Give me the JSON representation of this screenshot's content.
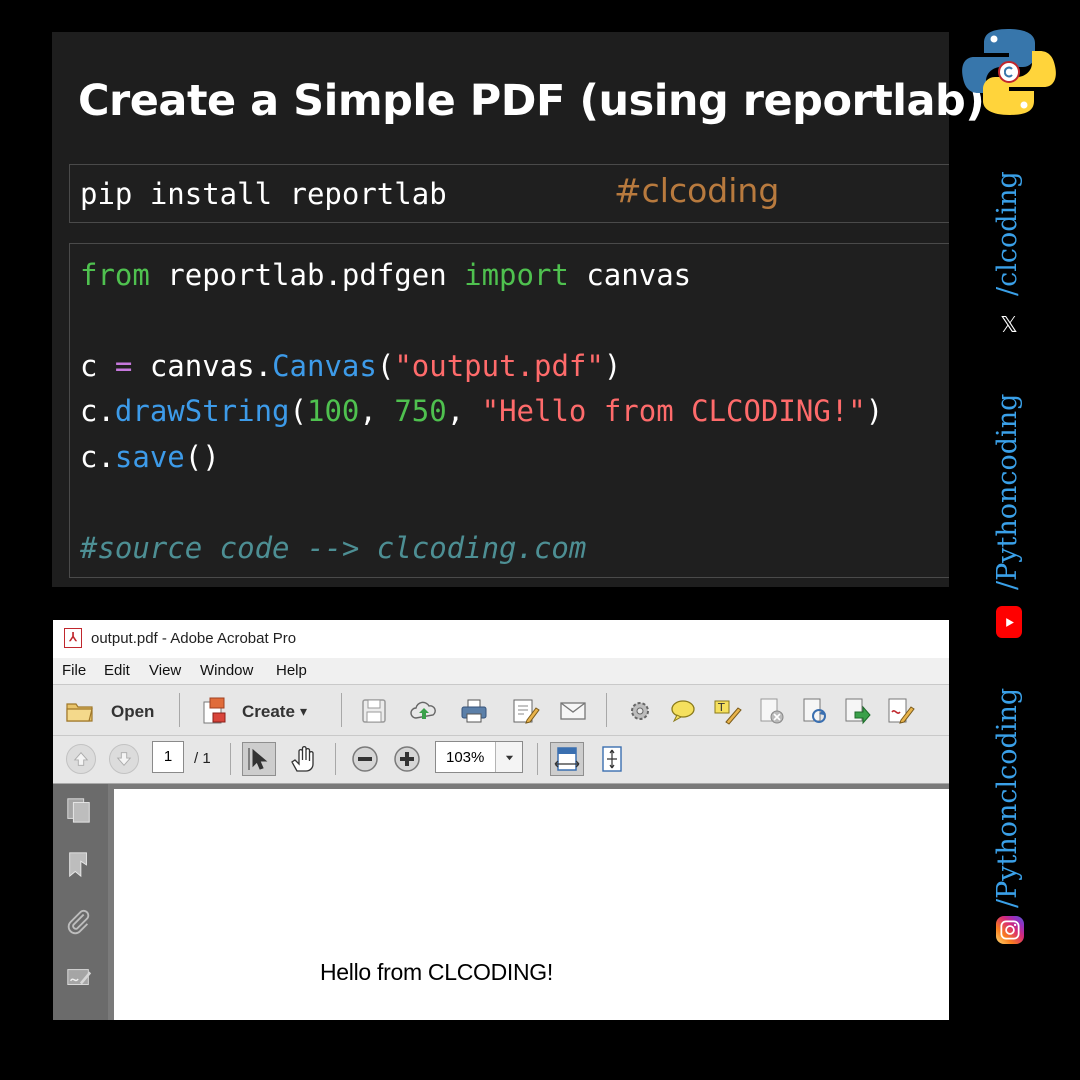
{
  "code_card": {
    "title": "Create a Simple PDF (using reportlab)",
    "install_cmd": "pip install reportlab",
    "hashtag": "#clcoding",
    "code": {
      "l1_kw1": "from",
      "l1_mod": " reportlab.pdfgen ",
      "l1_kw2": "import",
      "l1_name": " canvas",
      "l2_var": "c ",
      "l2_op": "=",
      "l2_obj": " canvas.",
      "l2_fn": "Canvas",
      "l2_open": "(",
      "l2_str": "\"output.pdf\"",
      "l2_close": ")",
      "l3_obj": "c.",
      "l3_fn": "drawString",
      "l3_open": "(",
      "l3_n1": "100",
      "l3_sep1": ", ",
      "l3_n2": "750",
      "l3_sep2": ", ",
      "l3_str": "\"Hello from CLCODING!\"",
      "l3_close": ")",
      "l4_obj": "c.",
      "l4_fn": "save",
      "l4_paren": "()",
      "comment": "#source code --> clcoding.com"
    }
  },
  "acrobat": {
    "window_title": "output.pdf - Adobe Acrobat Pro",
    "menu": [
      "File",
      "Edit",
      "View",
      "Window",
      "Help"
    ],
    "toolbar": {
      "open_label": "Open",
      "create_label": "Create",
      "create_arrow": "▾"
    },
    "nav": {
      "page_current": "1",
      "page_total": "/ 1",
      "zoom": "103%"
    },
    "page_text": "Hello from CLCODING!"
  },
  "social": {
    "handle_x": "/clcoding",
    "x_glyph": "𝕏",
    "handle_youtube": "/Pythoncoding",
    "handle_instagram": "/Pythonclcoding"
  },
  "colors": {
    "card_bg": "#1e1e1e",
    "keyword": "#4fc14f",
    "function": "#3d9be9",
    "string": "#ff6b6b",
    "operator": "#c678dd",
    "comment": "#4d8f94",
    "hashtag": "#b87a3e",
    "social_text": "#3aa0e8"
  }
}
